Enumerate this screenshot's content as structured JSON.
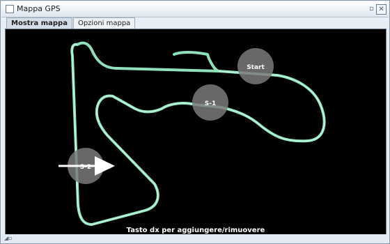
{
  "window": {
    "title": "Mappa GPS",
    "restore_glyph": "▫",
    "close_glyph": "✕"
  },
  "tabs": [
    {
      "label": "Mostra mappa",
      "active": true
    },
    {
      "label": "Opzioni mappa",
      "active": false
    }
  ],
  "map": {
    "markers": [
      {
        "label": "Start"
      },
      {
        "label": "S-1"
      },
      {
        "label": "S-2"
      }
    ],
    "hint": "Tasto dx per aggiungere/rimuovere",
    "track_color": "#8fe0bb",
    "marker_color": "#7a7a7a",
    "arrow_color": "#ffffff",
    "background": "#000000"
  },
  "status": {
    "grip_glyph": "◢▫"
  }
}
